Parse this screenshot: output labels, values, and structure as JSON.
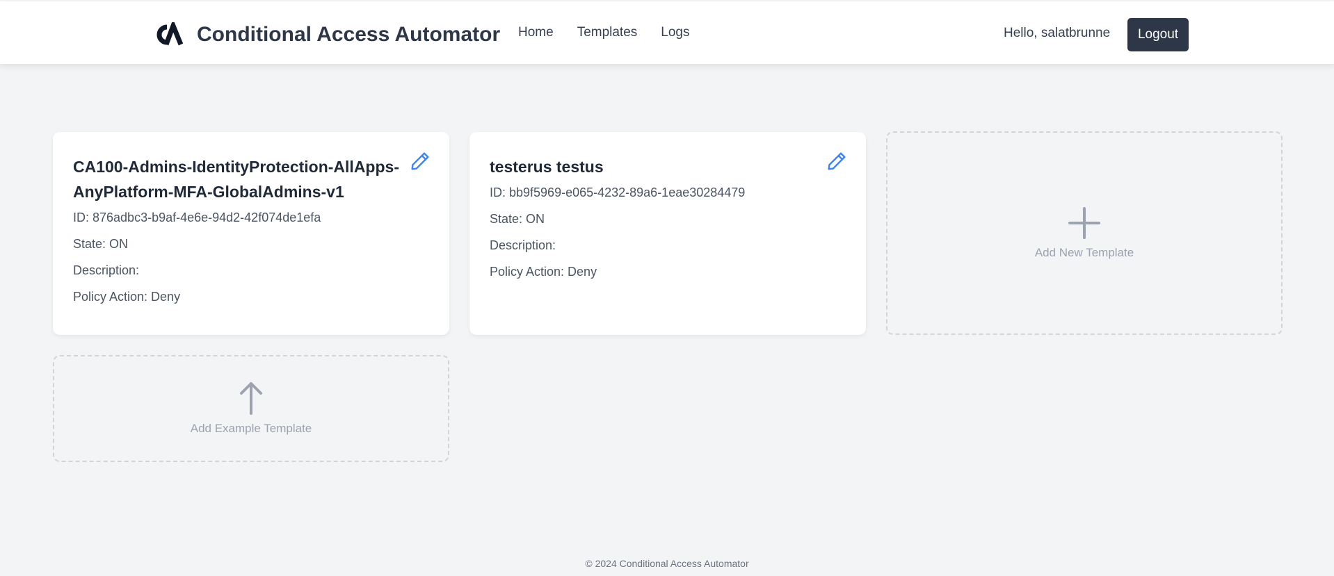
{
  "app": {
    "title": "Conditional Access Automator"
  },
  "nav": {
    "links": [
      {
        "label": "Home"
      },
      {
        "label": "Templates"
      },
      {
        "label": "Logs"
      }
    ],
    "greeting": "Hello, salatbrunne",
    "logout_label": "Logout"
  },
  "templates": [
    {
      "title": "CA100-Admins-IdentityProtection-AllApps-AnyPlatform-MFA-GlobalAdmins-v1",
      "id_text": "ID: 876adbc3-b9af-4e6e-94d2-42f074de1efa",
      "state_text": "State: ON",
      "description_text": "Description:",
      "policy_action_text": "Policy Action: Deny"
    },
    {
      "title": "testerus testus",
      "id_text": "ID: bb9f5969-e065-4232-89a6-1eae30284479",
      "state_text": "State: ON",
      "description_text": "Description:",
      "policy_action_text": "Policy Action: Deny"
    }
  ],
  "actions": {
    "add_new_label": "Add New Template",
    "add_example_label": "Add Example Template"
  },
  "footer": {
    "text": "© 2024 Conditional Access Automator"
  },
  "colors": {
    "background": "#f3f4f6",
    "navbar": "#ffffff",
    "logout_button": "#2d3748",
    "edit_icon": "#3b82f6",
    "dashed_border": "#d1d5db",
    "muted_text": "#9ca3af"
  },
  "icons": {
    "logo": "ca-logo-icon",
    "edit": "pencil-icon",
    "add_new": "plus-icon",
    "add_example": "arrow-up-icon"
  }
}
